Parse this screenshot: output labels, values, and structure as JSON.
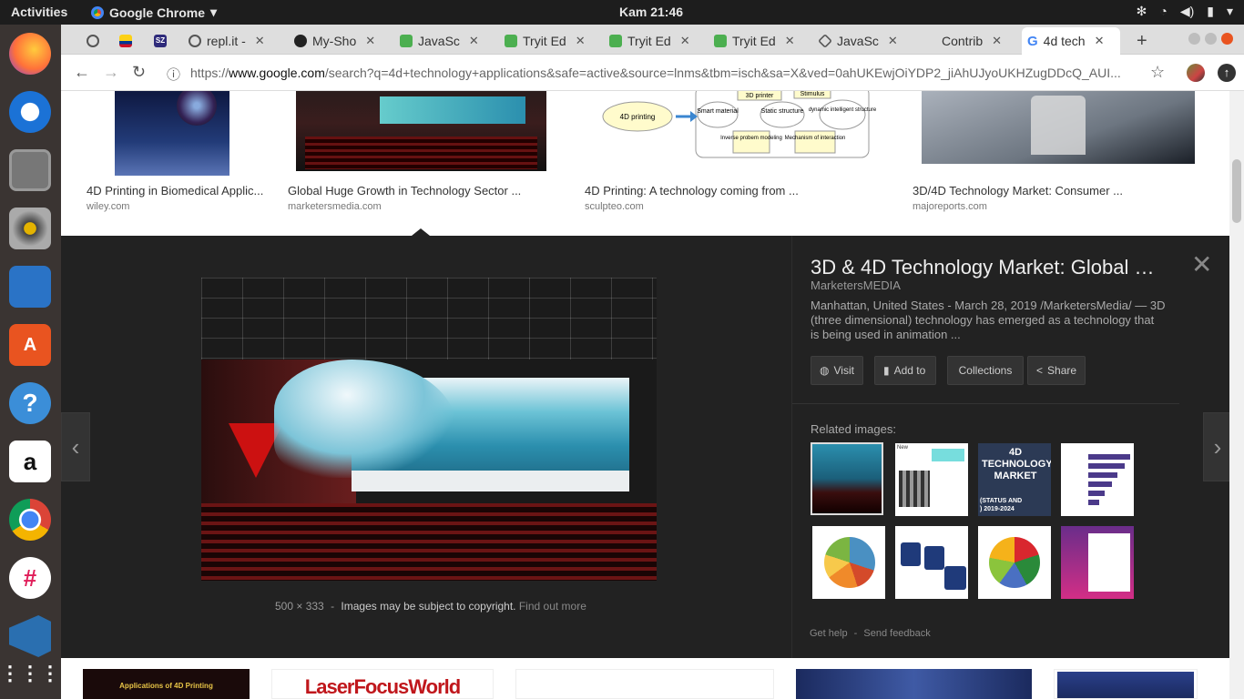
{
  "topbar": {
    "activities": "Activities",
    "app": "Google Chrome",
    "clock": "Kam 21:46"
  },
  "tabs": [
    {
      "title": ""
    },
    {
      "title": ""
    },
    {
      "title": ""
    },
    {
      "title": "repl.it -"
    },
    {
      "title": "My-Sho"
    },
    {
      "title": "JavaSc"
    },
    {
      "title": "Tryit Ed"
    },
    {
      "title": "Tryit Ed"
    },
    {
      "title": "Tryit Ed"
    },
    {
      "title": "JavaSc"
    },
    {
      "title": "Contrib"
    },
    {
      "title": "4d tech"
    }
  ],
  "favicon_labels": {
    "sz": "SZ"
  },
  "omnibox": {
    "scheme": "https://",
    "host": "www.google.com",
    "path": "/search?q=4d+technology+applications&safe=active&source=lnms&tbm=isch&sa=X&ved=0ahUKEwjOiYDP2_jiAhUJyoUKHZugDDcQ_AUI..."
  },
  "results": [
    {
      "caption": "4D Printing in Biomedical Applic...",
      "source": "wiley.com"
    },
    {
      "caption": "Global Huge Growth in Technology Sector ...",
      "source": "marketersmedia.com"
    },
    {
      "caption": "4D Printing: A technology coming from ...",
      "source": "sculpteo.com"
    },
    {
      "caption": "3D/4D Technology Market: Consumer ...",
      "source": "majoreports.com"
    }
  ],
  "diagram": {
    "nodes": [
      "3D printer",
      "Stimulus",
      "4D printing",
      "Smart material",
      "Static structure",
      "dynamic intelligent structure",
      "Inverse probem modeling",
      "Mechanism of interaction"
    ]
  },
  "preview": {
    "title": "3D & 4D Technology Market: Global …",
    "publisher": "MarketersMEDIA",
    "description": "Manhattan, United States - March 28, 2019 /MarketersMedia/ — 3D (three dimensional) technology has emerged as a technology that is being used in animation ...",
    "size": "500 × 333",
    "dash": "-",
    "copyright": "Images may be subject to copyright.",
    "find_out_more": "Find out more",
    "buttons": {
      "visit": "Visit",
      "add_to": "Add to",
      "collections": "Collections",
      "share": "Share"
    },
    "related_label": "Related images:",
    "related_thumb_text": {
      "market": "4D TECHNOLOGY MARKET",
      "status": "(STATUS AND",
      "years": ") 2019-2024",
      "new": "New"
    },
    "get_help": "Get help",
    "send_feedback": "Send feedback"
  },
  "bottom_row": {
    "applications": "Applications of 4D Printing",
    "laser": "LaserFocusWorld"
  },
  "colors": {
    "panel_bg": "#222222",
    "link": "#1a0dab",
    "dock_bg": "#3a3432",
    "wave": "#2b8fae"
  }
}
